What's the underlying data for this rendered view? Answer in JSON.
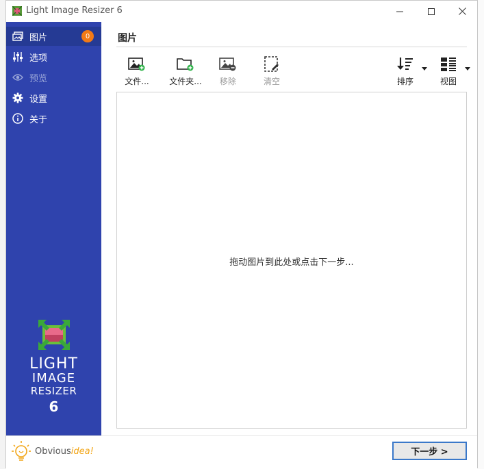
{
  "window": {
    "title": "Light Image Resizer 6"
  },
  "sidebar": {
    "items": [
      {
        "label": "图片",
        "badge": "0",
        "active": true,
        "icon": "pictures-icon"
      },
      {
        "label": "选项",
        "icon": "sliders-icon"
      },
      {
        "label": "预览",
        "disabled": true,
        "icon": "eye-icon"
      },
      {
        "label": "设置",
        "icon": "gear-icon"
      },
      {
        "label": "关于",
        "icon": "info-icon"
      }
    ],
    "brand": {
      "line1": "LIGHT",
      "line2": "IMAGE",
      "line3": "RESIZER",
      "line4": "6"
    },
    "vendor": {
      "part1": "Obvious",
      "part2": "idea!"
    }
  },
  "main": {
    "section_title": "图片",
    "toolbar": {
      "add_files": "文件...",
      "add_folder": "文件夹...",
      "remove": "移除",
      "clear": "清空",
      "sort": "排序",
      "view": "视图"
    },
    "drop_hint": "拖动图片到此处或点击下一步..."
  },
  "footer": {
    "next_label": "下一步 >"
  },
  "colors": {
    "sidebar": "#2f43ad",
    "accent_badge": "#f27a16",
    "add_green": "#2fb34a"
  }
}
